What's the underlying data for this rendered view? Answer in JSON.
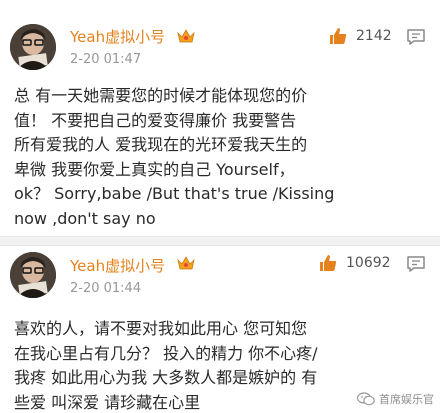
{
  "comments": [
    {
      "username": "Yeah虚拟小号",
      "time": "2-20 01:47",
      "likes": "2142",
      "text": "总 有一天她需要您的时候才能体现您的价\n值！ 不要把自己的爱变得廉价 我要警告\n所有爱我的人 爱我现在的光环爱我天生的\n卑微 我要你爱上真实的自己 Yourself，\nok？ Sorry,babe /But that's true /Kissing\nnow ,don't say no"
    },
    {
      "username": "Yeah虚拟小号",
      "time": "2-20 01:44",
      "likes": "10692",
      "text": "喜欢的人，请不要对我如此用心 您可知您\n在我心里占有几分？ 投入的精力 你不心疼/\n我疼 如此用心为我 大多数人都是嫉妒的 有\n些爱 叫深爱 请珍藏在心里"
    }
  ],
  "watermark": "首席娱乐官",
  "colors": {
    "username": "#e6821e",
    "time": "#999999",
    "text": "#2a2a2a",
    "crown": "#f2a31b"
  },
  "icons": [
    "avatar",
    "crown-icon",
    "thumbs-up-icon",
    "reply-icon",
    "wechat-icon"
  ]
}
